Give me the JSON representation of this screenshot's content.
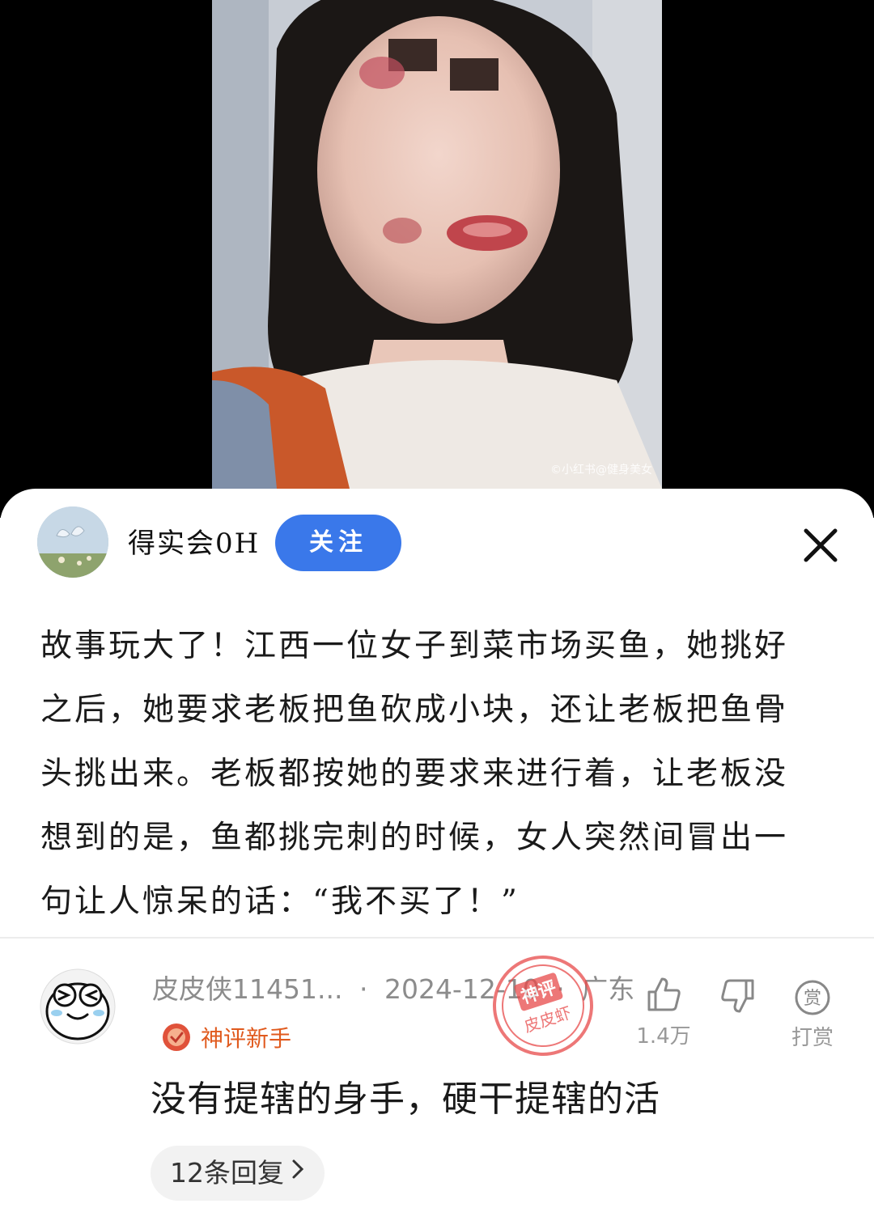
{
  "video": {
    "watermark": "©小红书@健身美女"
  },
  "post": {
    "author_name": "得实会0H",
    "follow_label": "关注",
    "text_lines": [
      "故事玩大了！江西一位女子到菜市场买鱼，她挑好",
      "之后，她要求老板把鱼砍成小块，还让老板把鱼骨",
      "头挑出来。老板都按她的要求来进行着，让老板没",
      "想到的是，鱼都挑完刺的时候，女人突然间冒出一",
      "句让人惊呆的话：“我不买了！”"
    ]
  },
  "comment": {
    "username": "皮皮侠11451...",
    "date": "2024-12-10",
    "location": "广东",
    "separator": "·",
    "badge": "神评新手",
    "text": "没有提辖的身手，硬干提辖的活",
    "replies_label": "12条回复",
    "like_count": "1.4万",
    "reward_label": "打赏",
    "reward_icon_char": "赏",
    "stamp_top": "神评",
    "stamp_bottom": "皮皮虾"
  },
  "colors": {
    "follow_button": "#3a78ea",
    "badge": "#e05a1e",
    "stamp": "#e84a4a"
  },
  "icons": [
    "close-icon",
    "thumbs-up-icon",
    "thumbs-down-icon",
    "reward-icon",
    "chevron-right-icon",
    "badge-medal-icon"
  ]
}
